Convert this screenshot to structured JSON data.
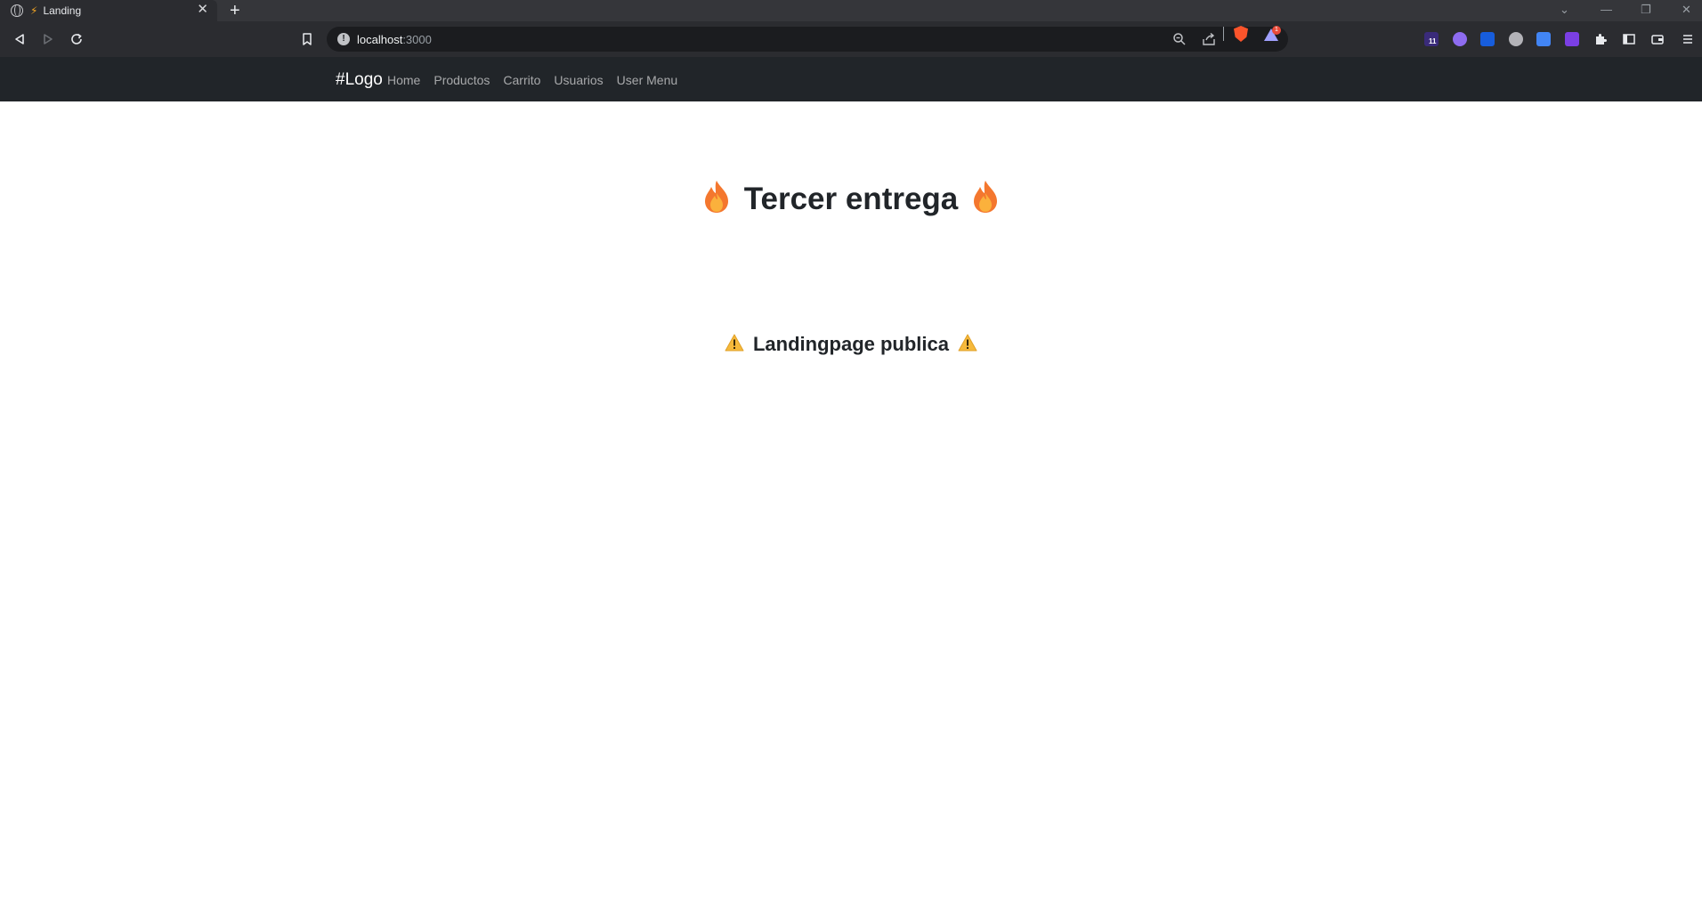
{
  "browser": {
    "tab": {
      "title": "Landing"
    },
    "address": {
      "host": "localhost",
      "port": ":3000"
    },
    "rewards_badge": "1",
    "extension_badge": "11"
  },
  "navbar": {
    "brand": "#Logo",
    "links": [
      {
        "label": "Home"
      },
      {
        "label": "Productos"
      },
      {
        "label": "Carrito"
      },
      {
        "label": "Usuarios"
      },
      {
        "label": "User Menu"
      }
    ]
  },
  "main": {
    "heading": "Tercer entrega",
    "heading_icon": "fire-icon",
    "subheading": "Landingpage publica",
    "subheading_icon": "warning-icon"
  }
}
